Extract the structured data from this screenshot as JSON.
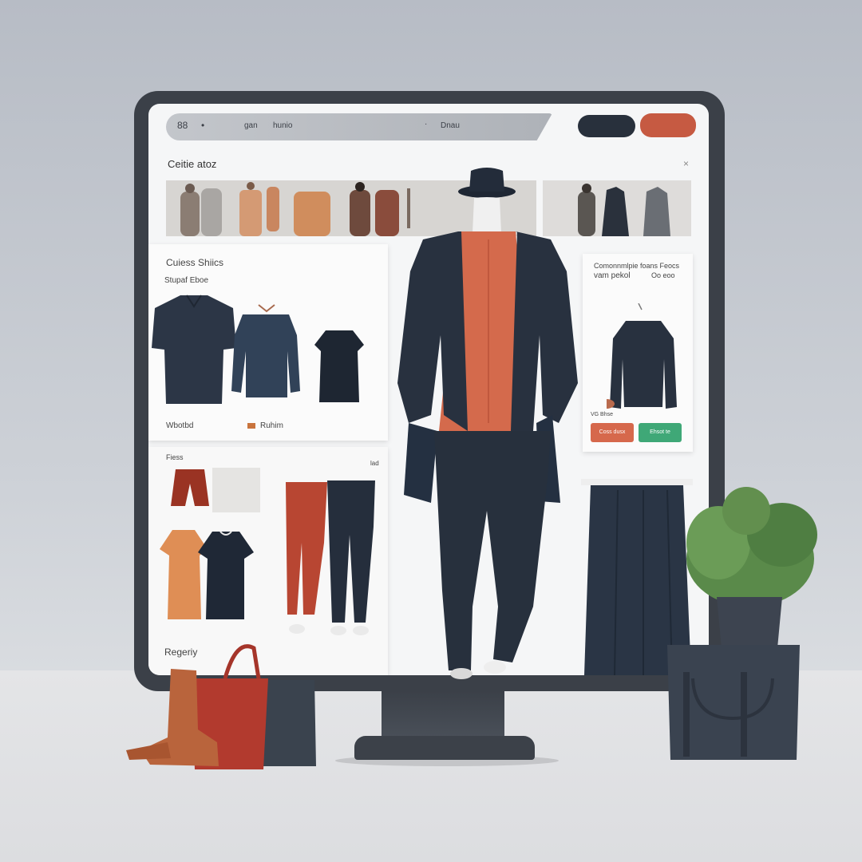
{
  "browser": {
    "address_left": "88",
    "address_mid1": "gan",
    "address_mid2": "hunio",
    "address_right": "Dnau"
  },
  "panel": {
    "title": "Ceitie atoz",
    "close": "×"
  },
  "shirts_card": {
    "title": "Cuiess Shiics",
    "subtitle": "Stupaf Eboe",
    "label_left": "Wbotbd",
    "label_right": "Ruhim"
  },
  "bottoms_card": {
    "title": "Fiess",
    "corner": "lad"
  },
  "promo_card": {
    "line1": "Comonnmlpie foans Feocs",
    "line2": "vam pekol",
    "line3": "Oo eoo",
    "label": "VG Bhse",
    "button_left": "Coss dusx",
    "button_right": "Ehsot te"
  },
  "footer_label": "Regeriy",
  "colors": {
    "accent_orange": "#c65a42",
    "accent_green": "#3fa877",
    "navy": "#27303d"
  }
}
